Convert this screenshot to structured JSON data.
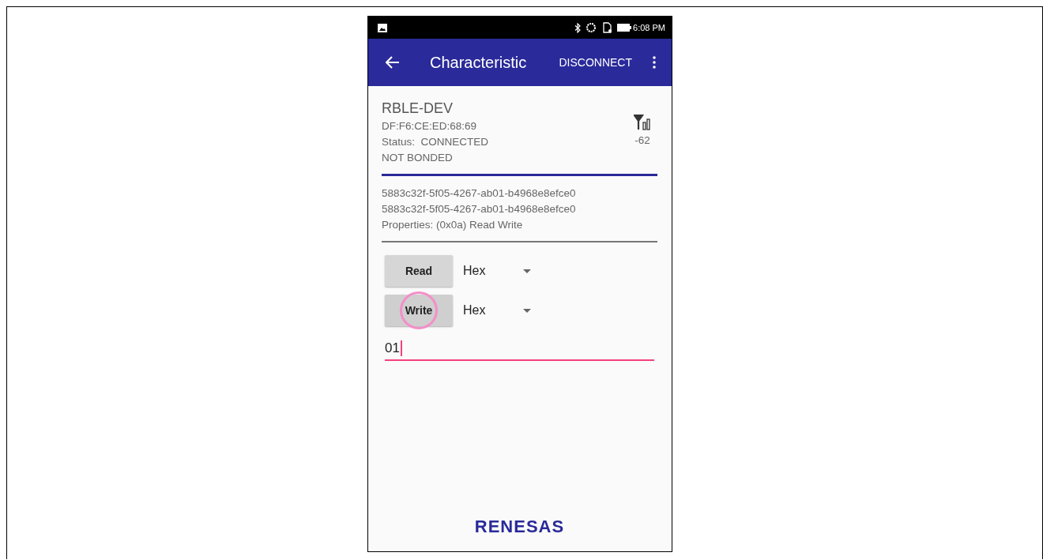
{
  "status_bar": {
    "time": "6:08 PM"
  },
  "app_bar": {
    "title": "Characteristic",
    "action": "DISCONNECT"
  },
  "device": {
    "name": "RBLE-DEV",
    "address": "DF:F6:CE:ED:68:69",
    "status": "Status:  CONNECTED",
    "bond": "NOT BONDED",
    "rssi": "-62"
  },
  "characteristic": {
    "uuid_lines": [
      "5883c32f-5f05-4267-ab01-b4968e8efce0",
      "5883c32f-5f05-4267-ab01-b4968e8efce0"
    ],
    "properties": "Properties: (0x0a) Read Write"
  },
  "operations": [
    {
      "button": "Read",
      "pressed": false,
      "format": "Hex"
    },
    {
      "button": "Write",
      "pressed": true,
      "format": "Hex"
    }
  ],
  "value_field": {
    "value": "01",
    "focused": true
  },
  "logo": "RENESAS"
}
